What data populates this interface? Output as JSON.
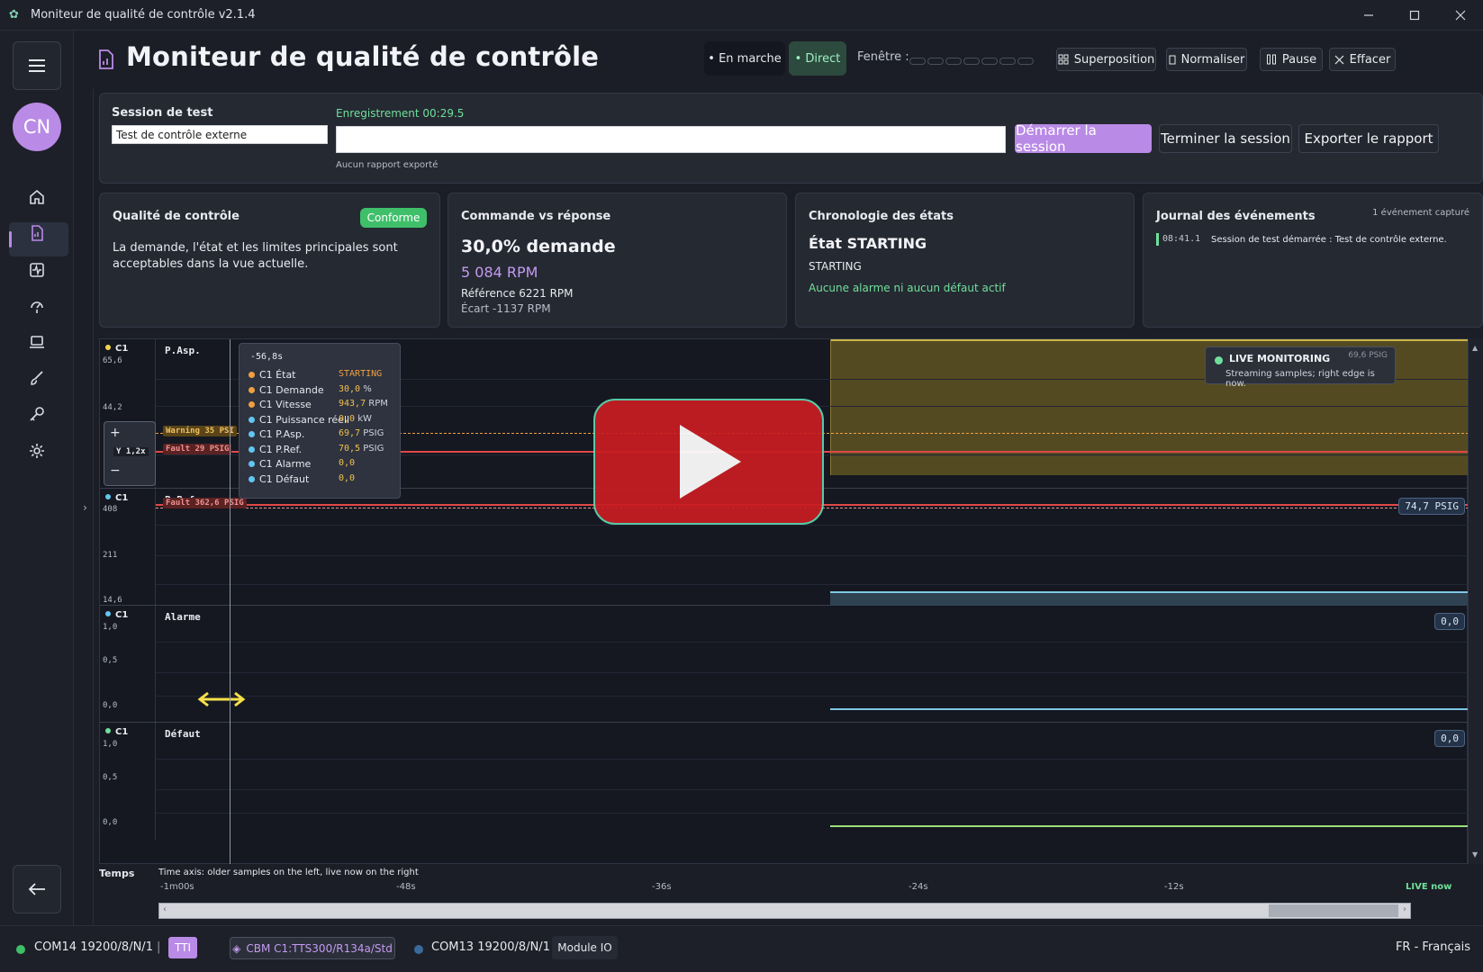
{
  "window": {
    "title": "Moniteur de qualité de contrôle v2.1.4"
  },
  "rail": {
    "avatar": "CN"
  },
  "header": {
    "title": "Moniteur de qualité de contrôle",
    "running": "• En marche",
    "live": "• Direct",
    "window_label": "Fenêtre :",
    "overlay": "Superposition",
    "normalize": "Normaliser",
    "pause": "Pause",
    "clear": "Effacer"
  },
  "session": {
    "label": "Session de test",
    "name_value": "Test de contrôle externe",
    "recording": "Enregistrement 00:29.5",
    "note": "Aucun rapport exporté",
    "start": "Démarrer la session",
    "end": "Terminer la session",
    "export": "Exporter le rapport"
  },
  "cards": {
    "quality": {
      "title": "Qualité de contrôle",
      "badge": "Conforme",
      "text": "La demande, l'état et les limites principales sont acceptables dans la vue actuelle."
    },
    "command": {
      "title": "Commande vs réponse",
      "demand": "30,0% demande",
      "rpm": "5 084 RPM",
      "reference": "Référence 6221 RPM",
      "deviation": "Écart -1137 RPM"
    },
    "timeline": {
      "title": "Chronologie des états",
      "state_title": "État STARTING",
      "state": "STARTING",
      "alarms": "Aucune alarme ni aucun défaut actif"
    },
    "events": {
      "title": "Journal des événements",
      "count": "1 événement capturé",
      "time": "08:41.1",
      "message": "Session de test démarrée : Test de contrôle externe."
    }
  },
  "charts": {
    "tooltip": {
      "time": "-56,8s",
      "rows": [
        {
          "label": "C1 État",
          "value": "STARTING",
          "unit": "",
          "color": "#f0a040",
          "vcolor": "#f0a040"
        },
        {
          "label": "C1 Demande",
          "value": "30,0",
          "unit": "%",
          "color": "#f0a040",
          "vcolor": "#f3c04e"
        },
        {
          "label": "C1 Vitesse",
          "value": "943,7",
          "unit": "RPM",
          "color": "#f0a040",
          "vcolor": "#f3c04e"
        },
        {
          "label": "C1 Puissance réell",
          "value": "0,0",
          "unit": "kW",
          "color": "#62c6f0",
          "vcolor": "#f3c04e"
        },
        {
          "label": "C1 P.Asp.",
          "value": "69,7",
          "unit": "PSIG",
          "color": "#62c6f0",
          "vcolor": "#f3c04e"
        },
        {
          "label": "C1 P.Ref.",
          "value": "70,5",
          "unit": "PSIG",
          "color": "#62c6f0",
          "vcolor": "#f3c04e"
        },
        {
          "label": "C1 Alarme",
          "value": "0,0",
          "unit": "",
          "color": "#62c6f0",
          "vcolor": "#f3c04e"
        },
        {
          "label": "C1 Défaut",
          "value": "0,0",
          "unit": "",
          "color": "#62c6f0",
          "vcolor": "#f3c04e"
        }
      ]
    },
    "live_title": "LIVE MONITORING",
    "live_sub": "Streaming samples; right edge is now.",
    "live_faint": "69,6 PSIG",
    "zoom_label": "Y 1,2x",
    "panes": [
      {
        "channel": "C1",
        "name": "P.Asp.",
        "ticks": [
          "65,6",
          "44,2"
        ],
        "warning": "Warning 35 PSI",
        "fault": "Fault 29 PSIG",
        "dot": "#f3d34e"
      },
      {
        "channel": "C1",
        "name": "P.Ref.",
        "ticks": [
          "408",
          "211",
          "14,6"
        ],
        "fault": "Fault 362,6 PSIG",
        "chip": "74,7 PSIG",
        "dot": "#62c6f0"
      },
      {
        "channel": "C1",
        "name": "Alarme",
        "ticks": [
          "1,0",
          "0,5",
          "0,0"
        ],
        "chip": "0,0",
        "dot": "#62c6f0"
      },
      {
        "channel": "C1",
        "name": "Défaut",
        "ticks": [
          "1,0",
          "0,5",
          "0,0"
        ],
        "chip": "0,0",
        "dot": "#6fe09a"
      }
    ]
  },
  "timeaxis": {
    "label": "Temps",
    "description": "Time axis: older samples on the left, live now on the right",
    "ticks": [
      "-1m00s",
      "-48s",
      "-36s",
      "-24s",
      "-12s"
    ],
    "live": "LIVE now"
  },
  "statusbar": {
    "port1": "COM14 19200/8/N/1",
    "sep": "|",
    "tt": "TTI",
    "model": "CBM C1:TTS300/R134a/Std",
    "port2": "COM13 19200/8/N/1",
    "module": "Module IO",
    "lang": "FR - Français"
  },
  "colors": {
    "accent": "#b98ae6",
    "ok": "#6fe09a",
    "warning": "#f0a040",
    "fault": "#e04848",
    "info": "#62c6f0"
  }
}
